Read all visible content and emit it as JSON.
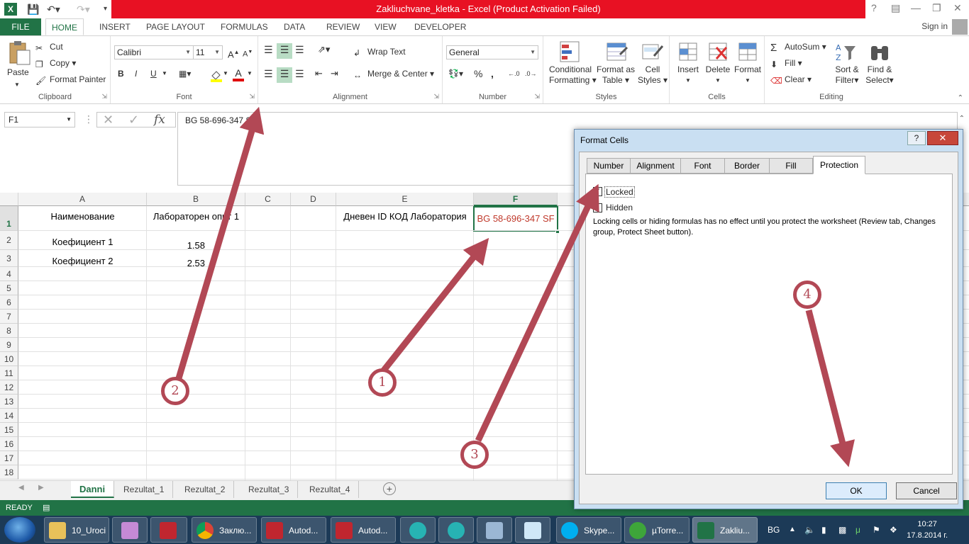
{
  "window": {
    "title": "Zakliuchvane_kletka - Excel (Product Activation Failed)",
    "help_button": "?",
    "sign_in": "Sign in"
  },
  "ribbon_tabs": [
    "FILE",
    "HOME",
    "INSERT",
    "PAGE LAYOUT",
    "FORMULAS",
    "DATA",
    "REVIEW",
    "VIEW",
    "DEVELOPER"
  ],
  "ribbon": {
    "clipboard": {
      "paste": "Paste",
      "cut": "Cut",
      "copy": "Copy",
      "format_painter": "Format Painter",
      "label": "Clipboard"
    },
    "font": {
      "family": "Calibri",
      "size": "11",
      "bold": "B",
      "italic": "I",
      "underline": "U",
      "label": "Font"
    },
    "alignment": {
      "wrap_text": "Wrap Text",
      "merge_center": "Merge & Center",
      "label": "Alignment"
    },
    "number": {
      "format": "General",
      "percent": "%",
      "comma": ",",
      "label": "Number"
    },
    "styles": {
      "conditional_1": "Conditional",
      "conditional_2": "Formatting",
      "format_table_1": "Format as",
      "format_table_2": "Table",
      "cell_styles_1": "Cell",
      "cell_styles_2": "Styles",
      "label": "Styles"
    },
    "cells": {
      "insert": "Insert",
      "delete": "Delete",
      "format": "Format",
      "label": "Cells"
    },
    "editing": {
      "autosum": "AutoSum",
      "fill": "Fill",
      "clear": "Clear",
      "sort_1": "Sort &",
      "sort_2": "Filter",
      "find_1": "Find &",
      "find_2": "Select",
      "label": "Editing"
    }
  },
  "formula_bar": {
    "name_box": "F1",
    "formula": "BG 58-696-347 SF"
  },
  "grid": {
    "columns": [
      "A",
      "B",
      "C",
      "D",
      "E",
      "F"
    ],
    "rows": [
      "1",
      "2",
      "3",
      "4",
      "5",
      "6",
      "7",
      "8",
      "9",
      "10",
      "11",
      "12",
      "13",
      "14",
      "15",
      "16",
      "17",
      "18"
    ],
    "cells": {
      "A1": "Наименование",
      "B1": "Лабораторен опит 1",
      "E1": "Дневен ID КОД Лаборатория",
      "F1": "BG 58-696-347 SF",
      "A2": "Коефициент 1",
      "B2": "1.58",
      "A3": "Коефициент 2",
      "B3": "2.53"
    }
  },
  "sheet_tabs": [
    "Danni",
    "Rezultat_1",
    "Rezultat_2",
    "Rezultat_3",
    "Rezultat_4"
  ],
  "status": {
    "ready": "READY"
  },
  "dialog": {
    "title": "Format Cells",
    "tabs": [
      "Number",
      "Alignment",
      "Font",
      "Border",
      "Fill",
      "Protection"
    ],
    "locked": "Locked",
    "hidden": "Hidden",
    "description": "Locking cells or hiding formulas has no effect until you protect the worksheet (Review tab, Changes group, Protect Sheet button).",
    "ok": "OK",
    "cancel": "Cancel"
  },
  "taskbar": {
    "items": [
      "10_Uroci",
      "Заклю...",
      "Autod...",
      "Autod...",
      "Skype...",
      "µTorre...",
      "Zakliu..."
    ],
    "lang": "BG",
    "time": "10:27",
    "date": "17.8.2014 г."
  },
  "annotations": [
    "1",
    "2",
    "3",
    "4"
  ],
  "colors": {
    "accent": "#217346",
    "title_bar": "#e81123",
    "annotation": "#b24855",
    "cell_red": "#c0392b"
  }
}
